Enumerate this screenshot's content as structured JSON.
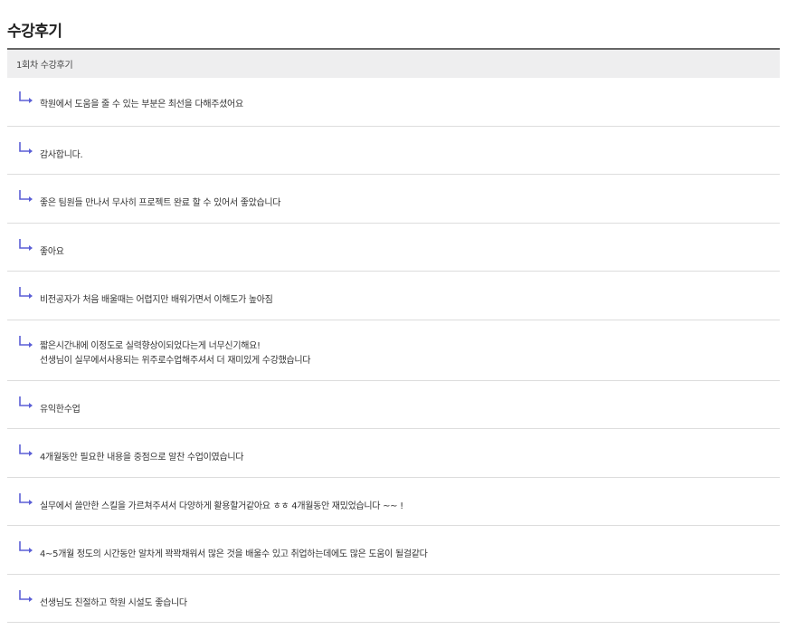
{
  "page": {
    "title": "수강후기"
  },
  "section": {
    "header": "1회차 수강후기"
  },
  "reviews": [
    {
      "text": "학원에서 도움을 줄 수 있는 부분은 최선을 다해주셨어요"
    },
    {
      "text": "감사합니다."
    },
    {
      "text": "좋은 팀원들 만나서 무사히 프로젝트 완료 할 수 있어서 좋았습니다"
    },
    {
      "text": "좋아요"
    },
    {
      "text": "비전공자가 처음 배울때는 어렵지만 배워가면서 이해도가 높아짐"
    },
    {
      "text": "짧은시간내에 이정도로 실력향상이되었다는게 너무신기해요!\n선생님이 실무에서사용되는 위주로수업해주셔서 더 재미있게 수강했습니다"
    },
    {
      "text": "유익한수업"
    },
    {
      "text": "4개월동안 필요한 내용을 중점으로 알찬 수업이였습니다"
    },
    {
      "text": "실무에서 쓸만한 스킬을 가르쳐주셔서 다양하게 활용할거같아요 ㅎㅎ 4개월동안 재밌었습니다 ~~ !"
    },
    {
      "text": "4~5개월 정도의 시간동안 알차게 꽉꽉채워서 많은 것을 배울수 있고 취업하는데에도 많은 도움이 될걸같다"
    },
    {
      "text": "선생님도 친절하고 학원 시설도 좋습니다"
    }
  ],
  "icons": {
    "reply": "reply-arrow-icon"
  },
  "colors": {
    "reply_icon": "#5b5fd6",
    "header_bg": "#eeeeef",
    "header_border": "#666666",
    "divider": "#dddddd"
  }
}
